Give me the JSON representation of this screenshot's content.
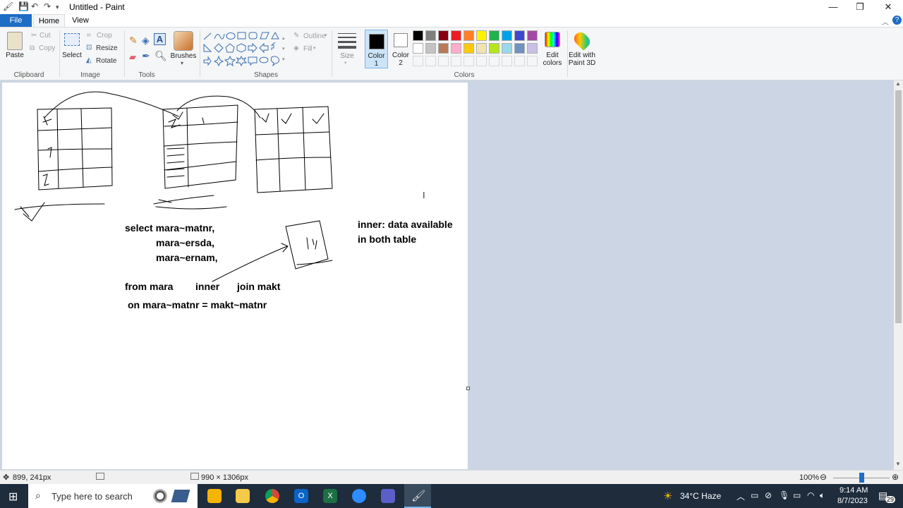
{
  "window": {
    "title": "Untitled - Paint",
    "minimize": "—",
    "restore": "❐",
    "close": "✕"
  },
  "tabs": {
    "file": "File",
    "home": "Home",
    "view": "View"
  },
  "ribbon": {
    "clipboard": {
      "label": "Clipboard",
      "paste": "Paste",
      "cut": "Cut",
      "copy": "Copy"
    },
    "image": {
      "label": "Image",
      "select": "Select",
      "crop": "Crop",
      "resize": "Resize",
      "rotate": "Rotate"
    },
    "tools": {
      "label": "Tools"
    },
    "brushes": "Brushes",
    "shapes": {
      "label": "Shapes",
      "outline": "Outline",
      "fill": "Fill"
    },
    "size": "Size",
    "color1": "Color 1",
    "color2": "Color 2",
    "colors_label": "Colors",
    "edit_colors": "Edit colors",
    "edit_paint3d": "Edit with Paint 3D",
    "palette_row1": [
      "#000000",
      "#7f7f7f",
      "#880015",
      "#ed1c24",
      "#ff7f27",
      "#fff200",
      "#22b14c",
      "#00a2e8",
      "#3f48cc",
      "#a349a4"
    ],
    "palette_row2": [
      "#ffffff",
      "#c3c3c3",
      "#b97a57",
      "#ffaec9",
      "#ffc90e",
      "#efe4b0",
      "#b5e61d",
      "#99d9ea",
      "#7092be",
      "#c8bfe7"
    ],
    "color1_value": "#000000",
    "color2_value": "#ffffff"
  },
  "canvas": {
    "line1": "select mara~matnr,",
    "line2": "mara~ersda,",
    "line3": "mara~ernam,",
    "from": "from mara",
    "inner": "inner",
    "join": "join makt",
    "on": "on mara~matnr = makt~matnr",
    "note1": "inner: data available",
    "note2": "in both table"
  },
  "status": {
    "cursor": "899, 241px",
    "size": "990 × 1306px",
    "zoom": "100%",
    "zoom_level": 1.0
  },
  "taskbar": {
    "search_placeholder": "Type here to search",
    "weather": "34°C  Haze",
    "time": "9:14 AM",
    "date": "8/7/2023",
    "notifications": "29"
  }
}
